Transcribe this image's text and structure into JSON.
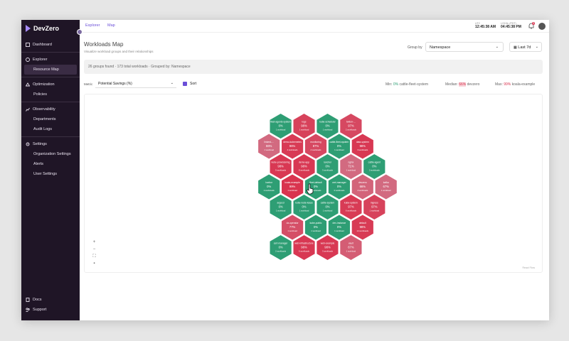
{
  "app": {
    "name": "DevZero"
  },
  "colors": {
    "sidebar": "#1f1526",
    "accent": "#6b4fd8",
    "low": "#2e9e74",
    "high": "#d9344f"
  },
  "sidebar": {
    "items": [
      {
        "label": "Dashboard",
        "icon": "dashboard-icon"
      },
      {
        "label": "Explorer",
        "icon": "compass-icon"
      },
      {
        "label": "Resource Map",
        "icon": "",
        "sub": true,
        "active": true
      },
      {
        "label": "Optimization",
        "icon": "optimization-icon"
      },
      {
        "label": "Policies",
        "icon": "",
        "sub": true
      },
      {
        "label": "Observability",
        "icon": "chart-icon"
      },
      {
        "label": "Departments",
        "icon": "",
        "sub": true
      },
      {
        "label": "Audit Logs",
        "icon": "",
        "sub": true
      },
      {
        "label": "Settings",
        "icon": "gear-icon"
      },
      {
        "label": "Organization Settings",
        "icon": "",
        "sub": true
      },
      {
        "label": "Alerts",
        "icon": "",
        "sub": true
      },
      {
        "label": "User Settings",
        "icon": "",
        "sub": true
      }
    ],
    "footer": [
      {
        "label": "Docs",
        "icon": "docs-icon"
      },
      {
        "label": "Support",
        "icon": "support-icon"
      }
    ]
  },
  "topbar": {
    "breadcrumb": [
      "Explorer",
      "Map"
    ],
    "clocks": [
      {
        "label": "UTC",
        "value": "12:45:38 AM"
      },
      {
        "label": "LOCAL (PDT)",
        "value": "04:45:38 PM"
      }
    ],
    "notifications": "9"
  },
  "header": {
    "title": "Workloads Map",
    "subtitle": "Visualize workload groups and their relationships",
    "group_by_label": "Group by",
    "group_by_value": "Namespace",
    "range_value": "Last 7d"
  },
  "info": {
    "text": "26 groups found · 173 total workloads · Grouped by: Namespace"
  },
  "controls": {
    "metric_label": "Metric",
    "metric_value": "Potential Savings (%)",
    "sort_label": "Sort"
  },
  "stats": {
    "min_label": "Min:",
    "min_value": "0%",
    "min_name": "cattle-fleet-system",
    "median_label": "Median:",
    "median_value": "66%",
    "median_name": "devzero",
    "max_label": "Max:",
    "max_value": "99%",
    "max_name": "koala-example"
  },
  "map": {
    "footer": "React Flow",
    "hexes": [
      {
        "name": "fleet-default",
        "value": "0%",
        "sub": "2 workloads",
        "level": 0
      },
      {
        "name": "kube-node-lease",
        "value": "0%",
        "sub": "1 workload",
        "level": 0
      },
      {
        "name": "cattle-system",
        "value": "0%",
        "sub": "1 workload",
        "level": 0
      },
      {
        "name": "cert-manager",
        "value": "0%",
        "sub": "3 workloads",
        "level": 0
      },
      {
        "name": "rancher",
        "value": "0%",
        "sub": "3 workloads",
        "level": 0
      },
      {
        "name": "demo-app",
        "value": "98%",
        "sub": "8 workloads",
        "level": 0.97
      },
      {
        "name": "koala-example",
        "value": "99%",
        "sub": "1 workload",
        "level": 1
      },
      {
        "name": "dz-operator",
        "value": "77%",
        "sub": "1 workload",
        "level": 0.8
      },
      {
        "name": "kube-public",
        "value": "0%",
        "sub": "1 workload",
        "level": 0
      },
      {
        "name": "dev-instance",
        "value": "0%",
        "sub": "1 workload",
        "level": 0
      },
      {
        "name": "kube-system",
        "value": "97%",
        "sub": "6 workloads",
        "level": 0.95
      },
      {
        "name": "devzero",
        "value": "66%",
        "sub": "4 workloads",
        "level": 0.65
      },
      {
        "name": "nginx",
        "value": "71%",
        "sub": "1 workload",
        "level": 0.6
      },
      {
        "name": "cattle-fleet-system",
        "value": "0%",
        "sub": "1 workload",
        "level": 0
      },
      {
        "name": "monitoring",
        "value": "87%",
        "sub": "4 workloads",
        "level": 0.85
      },
      {
        "name": "demo-kubernetes",
        "value": "96%",
        "sub": "4 workloads",
        "level": 0.95
      },
      {
        "name": "kube-provisioning",
        "value": "98%",
        "sub": "5 workloads",
        "level": 0.97
      },
      {
        "name": "harbor",
        "value": "0%",
        "sub": "2 workloads",
        "level": 0
      },
      {
        "name": "argocd",
        "value": "0%",
        "sub": "1 workload",
        "level": 0
      },
      {
        "name": "cert-manager",
        "value": "0%",
        "sub": "2 workloads",
        "level": 0
      },
      {
        "name": "web-infrastructure",
        "value": "98%",
        "sub": "6 workloads",
        "level": 0.97
      },
      {
        "name": "web-example",
        "value": "98%",
        "sub": "3 workloads",
        "level": 0.97
      },
      {
        "name": "vault",
        "value": "67%",
        "sub": "1 workload",
        "level": 0.7
      },
      {
        "name": "default",
        "value": "98%",
        "sub": "14 workloads",
        "level": 0.95
      },
      {
        "name": "ingress",
        "value": "97%",
        "sub": "1 workload",
        "level": 0.9
      },
      {
        "name": "kafka",
        "value": "67%",
        "sub": "1 workload",
        "level": 0.6
      },
      {
        "name": "cattle-agent",
        "value": "0%",
        "sub": "2 workloads",
        "level": 0
      },
      {
        "name": "data-system",
        "value": "98%",
        "sub": "3 workloads",
        "level": 0.97
      },
      {
        "name": "tekton-...",
        "value": "97%",
        "sub": "2 workloads",
        "level": 0.85
      },
      {
        "name": "kube-scheduler",
        "value": "0%",
        "sub": "1 workload",
        "level": 0
      },
      {
        "name": "logs",
        "value": "98%",
        "sub": "1 workload",
        "level": 0.9
      },
      {
        "name": "fleet-agents-system",
        "value": "0%",
        "sub": "1 workload",
        "level": 0
      },
      {
        "name": "linkerd-...",
        "value": "86%",
        "sub": "1 workload",
        "level": 0.6
      }
    ]
  }
}
